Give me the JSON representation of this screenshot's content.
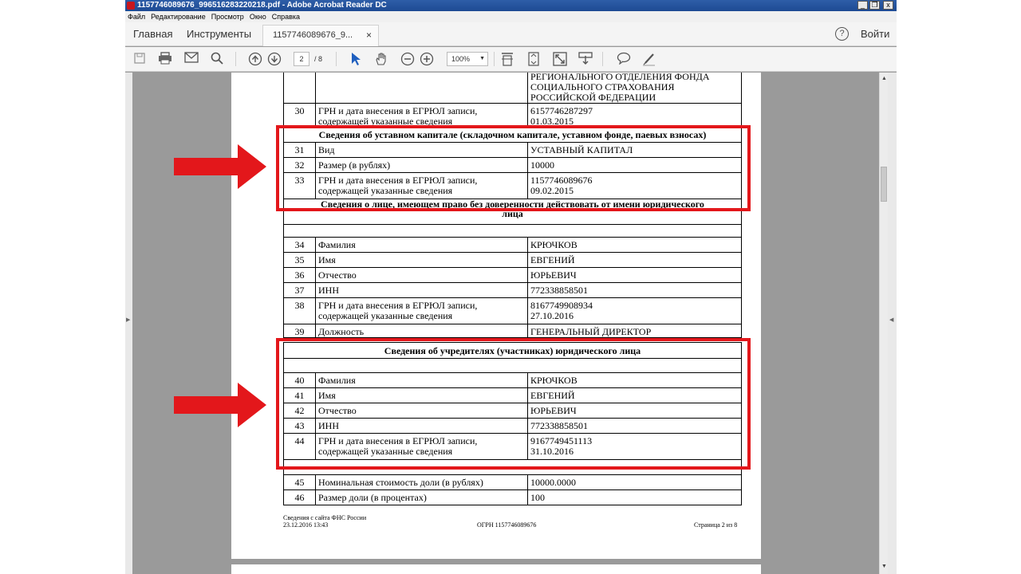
{
  "window": {
    "title": "1157746089676_996516283220218.pdf - Adobe Acrobat Reader DC",
    "min_btn": "_",
    "max_btn": "❐",
    "close_btn": "x"
  },
  "menu": [
    "Файл",
    "Редактирование",
    "Просмотр",
    "Окно",
    "Справка"
  ],
  "tabs": {
    "home": "Главная",
    "tools": "Инструменты",
    "document": "1157746089676_9...",
    "close": "×",
    "help": "?",
    "signin": "Войти"
  },
  "toolbar": {
    "page_current": "2",
    "page_total": "/ 8",
    "zoom": "100%"
  },
  "table_top": {
    "cont_row": {
      "num": "",
      "field": "",
      "value": "РЕГИОНАЛЬНОГО ОТДЕЛЕНИЯ ФОНДА\nСОЦИАЛЬНОГО СТРАХОВАНИЯ\nРОССИЙСКОЙ ФЕДЕРАЦИИ"
    },
    "row30": {
      "num": "30",
      "field": "ГРН и дата внесения в ЕГРЮЛ записи,\nсодержащей указанные сведения",
      "value": "6157746287297\n01.03.2015"
    },
    "section_capital": "Сведения об уставном капитале (складочном капитале, уставном фонде, паевых взносах)",
    "row31": {
      "num": "31",
      "field": "Вид",
      "value": "УСТАВНЫЙ КАПИТАЛ"
    },
    "row32": {
      "num": "32",
      "field": "Размер (в рублях)",
      "value": "10000"
    },
    "row33": {
      "num": "33",
      "field": "ГРН и дата внесения в ЕГРЮЛ записи,\nсодержащей указанные сведения",
      "value": "1157746089676\n09.02.2015"
    },
    "section_person": "Сведения о лице, имеющем право без доверенности действовать от имени юридического\nлица",
    "row34": {
      "num": "34",
      "field": "Фамилия",
      "value": "КРЮЧКОВ"
    },
    "row35": {
      "num": "35",
      "field": "Имя",
      "value": "ЕВГЕНИЙ"
    },
    "row36": {
      "num": "36",
      "field": "Отчество",
      "value": "ЮРЬЕВИЧ"
    },
    "row37": {
      "num": "37",
      "field": "ИНН",
      "value": "772338858501"
    },
    "row38": {
      "num": "38",
      "field": "ГРН и дата внесения в ЕГРЮЛ записи,\nсодержащей указанные сведения",
      "value": "8167749908934\n27.10.2016"
    },
    "row39": {
      "num": "39",
      "field": "Должность",
      "value": "ГЕНЕРАЛЬНЫЙ ДИРЕКТОР"
    }
  },
  "table_bottom": {
    "section_founders": "Сведения об учредителях (участниках) юридического лица",
    "row40": {
      "num": "40",
      "field": "Фамилия",
      "value": "КРЮЧКОВ"
    },
    "row41": {
      "num": "41",
      "field": "Имя",
      "value": "ЕВГЕНИЙ"
    },
    "row42": {
      "num": "42",
      "field": "Отчество",
      "value": "ЮРЬЕВИЧ"
    },
    "row43": {
      "num": "43",
      "field": "ИНН",
      "value": "772338858501"
    },
    "row44": {
      "num": "44",
      "field": "ГРН и дата внесения в ЕГРЮЛ записи,\nсодержащей указанные сведения",
      "value": "9167749451113\n31.10.2016"
    },
    "row45": {
      "num": "45",
      "field": "Номинальная стоимость доли (в рублях)",
      "value": "10000.0000"
    },
    "row46": {
      "num": "46",
      "field": "Размер доли (в процентах)",
      "value": "100"
    }
  },
  "footer": {
    "source": "Сведения с сайта ФНС России",
    "datetime": "23.12.2016 13:43",
    "ogrn": "ОГРН 1157746089676",
    "page": "Страница 2 из 8"
  },
  "colors": {
    "highlight": "#e3171b",
    "titlebar": "#1d4a93",
    "viewer_bg": "#9a9a9a"
  }
}
